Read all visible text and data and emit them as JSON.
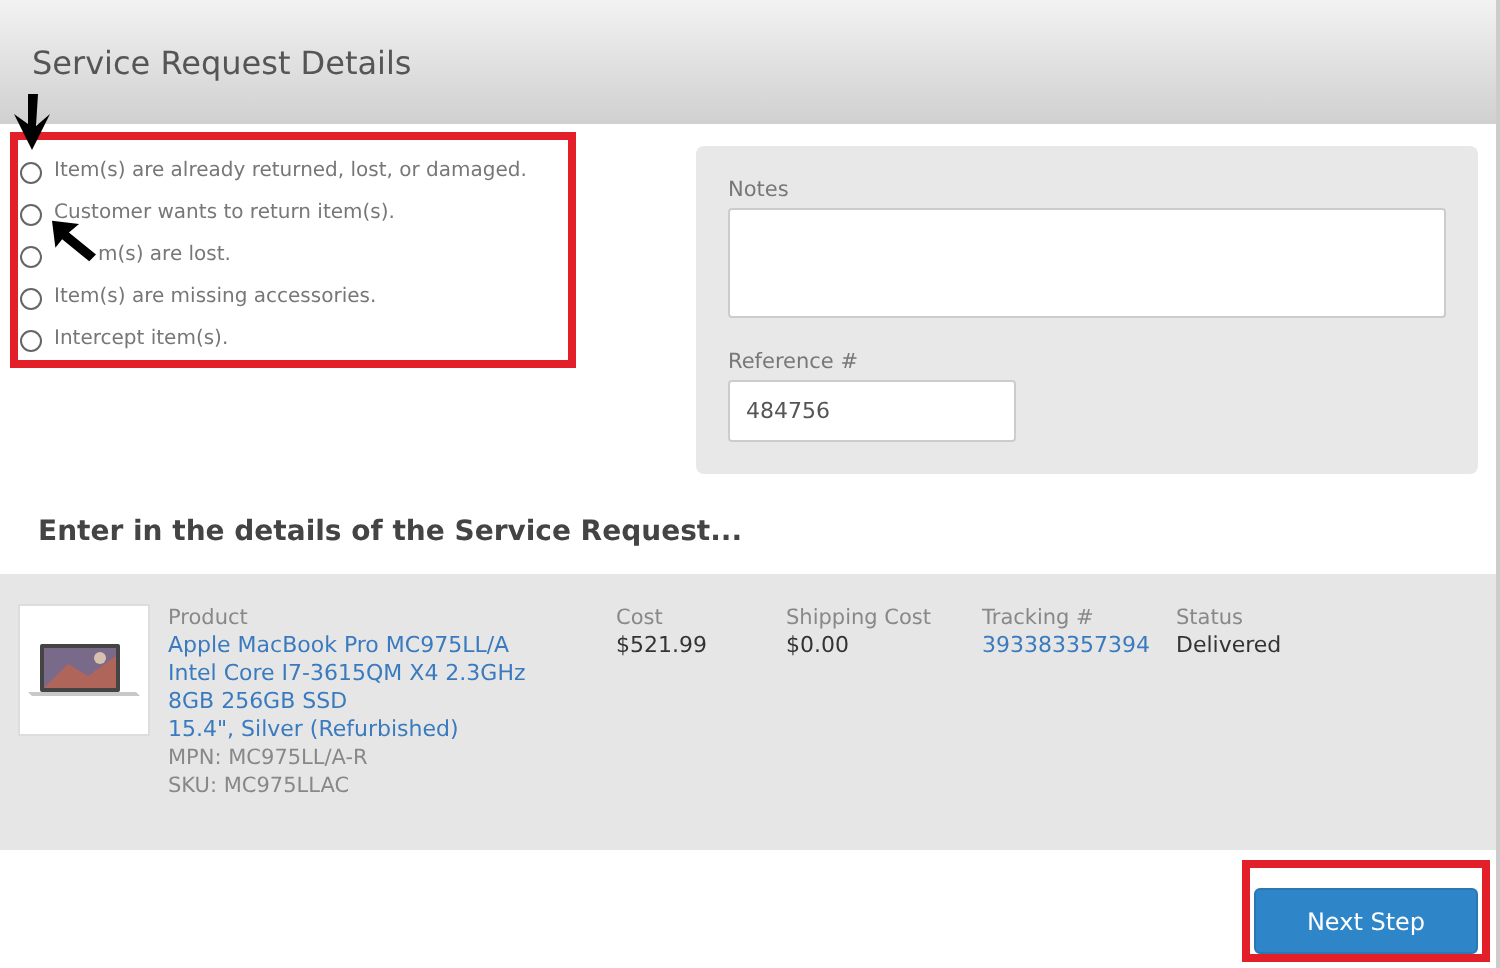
{
  "header": {
    "title": "Service Request Details"
  },
  "reasons": [
    {
      "label": "Item(s) are already returned, lost, or damaged.",
      "selected": false
    },
    {
      "label": "Customer wants to return item(s).",
      "selected": false
    },
    {
      "label": "m(s) are lost.",
      "selected": false,
      "kind": "covered"
    },
    {
      "label": "Item(s) are missing accessories.",
      "selected": false
    },
    {
      "label": "Intercept item(s).",
      "selected": false
    }
  ],
  "notes": {
    "label": "Notes"
  },
  "reference": {
    "label": "Reference #",
    "value": "484756"
  },
  "section_heading": "Enter in the details of the Service Request...",
  "item": {
    "product_label": "Product",
    "product_lines": [
      "Apple MacBook Pro MC975LL/A",
      "Intel Core I7-3615QM X4 2.3GHz",
      "8GB 256GB SSD",
      "15.4\", Silver (Refurbished)"
    ],
    "mpn": "MPN: MC975LL/A-R",
    "sku": "SKU: MC975LLAC",
    "fields": [
      {
        "label": "Cost",
        "value": "$521.99",
        "kind": "text"
      },
      {
        "label": "Shipping Cost",
        "value": "$0.00",
        "kind": "text"
      },
      {
        "label": "Tracking #",
        "value": "393383357394",
        "kind": "link"
      },
      {
        "label": "Status",
        "value": "Delivered",
        "kind": "text"
      }
    ]
  },
  "next_button": "Next Step"
}
